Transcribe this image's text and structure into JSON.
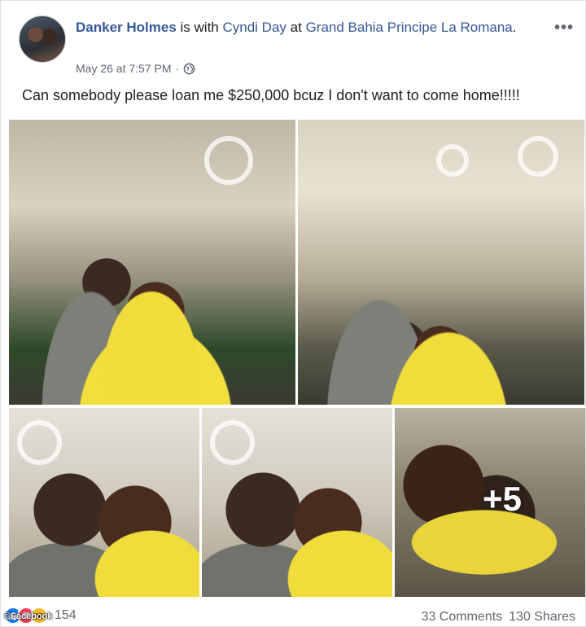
{
  "post": {
    "author": "Danker Holmes",
    "with_text": "is with",
    "tagged": "Cyndi Day",
    "at_text": "at",
    "location": "Grand Bahia Principe La Romana",
    "period": ".",
    "timestamp": "May 26 at 7:57 PM",
    "separator": "·",
    "privacy_icon": "globe-icon",
    "more_icon": "ellipsis-icon",
    "more_label": "•••",
    "status": "Can somebody please loan me $250,000 bcuz I don't want to come home!!!!!",
    "more_photos_label": "+5"
  },
  "footer": {
    "reaction_icons": [
      "like-icon",
      "love-icon",
      "haha-icon"
    ],
    "reaction_count": "154",
    "comments": "33 Comments",
    "shares": "130 Shares",
    "watermark": "©Facebook"
  },
  "colors": {
    "link": "#365899",
    "meta": "#606770",
    "like": "#1877f2",
    "love": "#f33e58",
    "haha": "#f7b928"
  }
}
